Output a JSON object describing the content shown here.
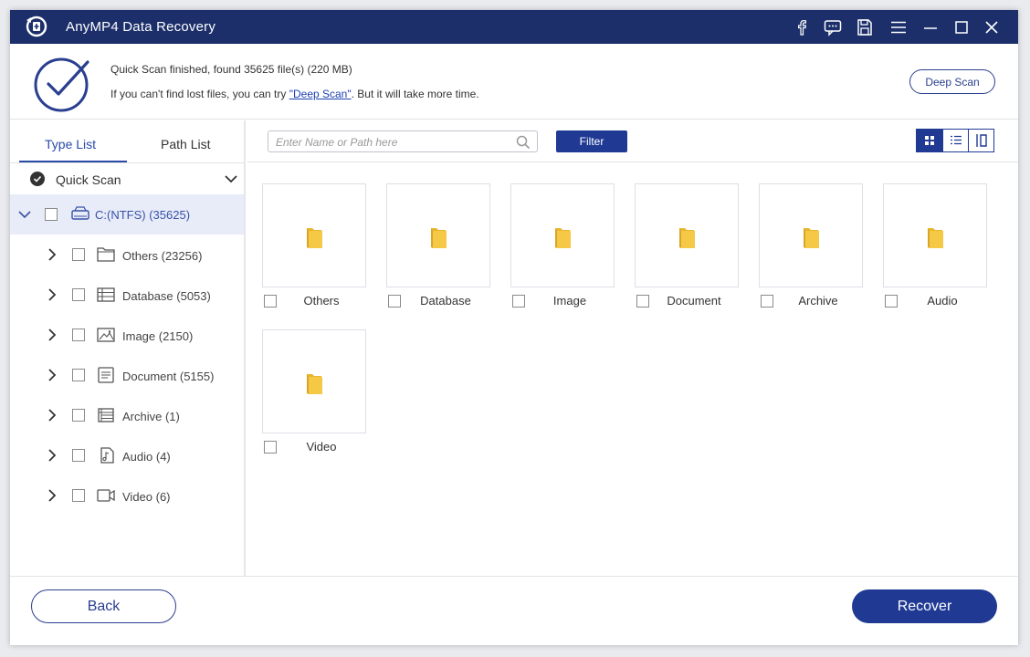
{
  "window": {
    "title": "AnyMP4 Data Recovery",
    "titlebar_icons": [
      "facebook-icon",
      "feedback-icon",
      "save-icon",
      "menu-icon",
      "minimize-icon",
      "maximize-icon",
      "close-icon"
    ]
  },
  "scan": {
    "status": "Quick Scan finished, found 35625 file(s) (220 MB)",
    "hint_prefix": "If you can't find lost files, you can try ",
    "hint_link": "\"Deep Scan\"",
    "hint_suffix": ". But it will take more time.",
    "deep_scan_label": "Deep Scan"
  },
  "sidebar": {
    "tabs": [
      {
        "label": "Type List",
        "active": true
      },
      {
        "label": "Path List",
        "active": false
      }
    ],
    "quick_scan_label": "Quick Scan",
    "drive": {
      "label": "C:(NTFS) (35625)"
    },
    "items": [
      {
        "label": "Others (23256)",
        "icon": "folder-icon"
      },
      {
        "label": "Database (5053)",
        "icon": "database-icon"
      },
      {
        "label": "Image (2150)",
        "icon": "image-icon"
      },
      {
        "label": "Document (5155)",
        "icon": "document-icon"
      },
      {
        "label": "Archive (1)",
        "icon": "archive-icon"
      },
      {
        "label": "Audio (4)",
        "icon": "audio-icon"
      },
      {
        "label": "Video (6)",
        "icon": "video-icon"
      }
    ]
  },
  "toolbar": {
    "search_placeholder": "Enter Name or Path here",
    "filter_label": "Filter",
    "view_modes": [
      "grid-view-icon",
      "list-view-icon",
      "detail-view-icon"
    ]
  },
  "grid": {
    "tiles": [
      {
        "label": "Others"
      },
      {
        "label": "Database"
      },
      {
        "label": "Image"
      },
      {
        "label": "Document"
      },
      {
        "label": "Archive"
      },
      {
        "label": "Audio"
      },
      {
        "label": "Video"
      }
    ]
  },
  "footer": {
    "back_label": "Back",
    "recover_label": "Recover"
  },
  "colors": {
    "titlebar": "#1c2f6b",
    "accent": "#203a94",
    "folder": "#f5c945"
  }
}
